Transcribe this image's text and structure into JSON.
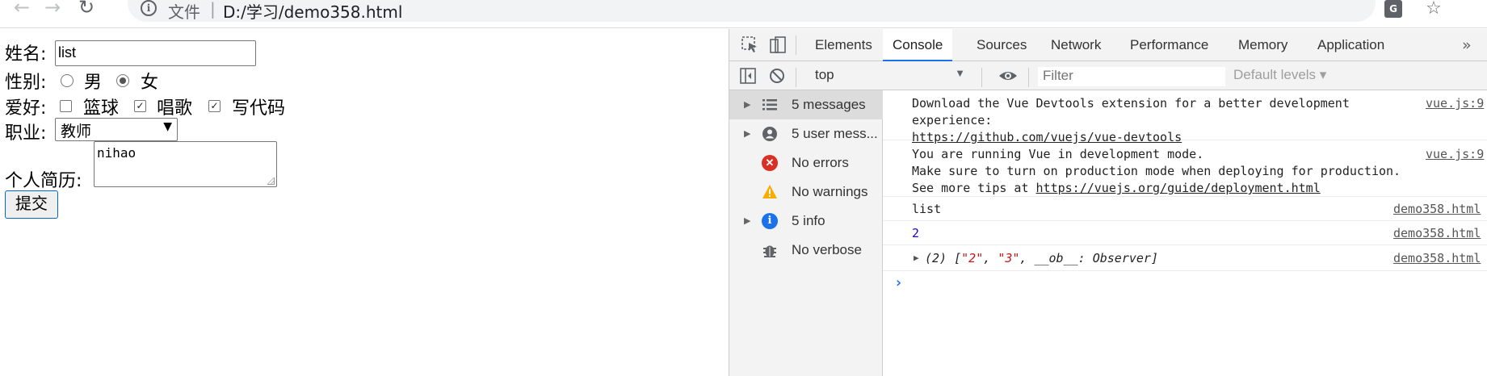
{
  "browser": {
    "back_glyph": "←",
    "forward_glyph": "→",
    "reload_glyph": "↻",
    "info_glyph": "i",
    "file_label": "文件",
    "separator": "|",
    "url": "D:/学习/demo358.html",
    "translate_glyph": "G",
    "star_glyph": "☆"
  },
  "form": {
    "name_label": "姓名:",
    "name_value": "list",
    "gender_label": "性别:",
    "gender_options": [
      "男",
      "女"
    ],
    "gender_selected": "女",
    "hobby_label": "爱好:",
    "hobbies": [
      {
        "label": "篮球",
        "checked": false
      },
      {
        "label": "唱歌",
        "checked": true
      },
      {
        "label": "写代码",
        "checked": true
      }
    ],
    "job_label": "职业:",
    "job_value": "教师",
    "resume_label": "个人简历:",
    "resume_value": "nihao",
    "submit_label": "提交"
  },
  "devtools": {
    "tabs": [
      "Elements",
      "Console",
      "Sources",
      "Network",
      "Performance",
      "Memory",
      "Application"
    ],
    "active_tab": "Console",
    "more_glyph": "»",
    "context": "top",
    "filter_placeholder": "Filter",
    "levels_label": "Default levels ▾",
    "sidebar": [
      {
        "label": "5 messages",
        "icon": "list-icon",
        "expandable": true,
        "selected": true
      },
      {
        "label": "5 user mess...",
        "icon": "user-icon",
        "expandable": true
      },
      {
        "label": "No errors",
        "icon": "error-icon",
        "expandable": false
      },
      {
        "label": "No warnings",
        "icon": "warning-icon",
        "expandable": false
      },
      {
        "label": "5 info",
        "icon": "info-icon",
        "expandable": true
      },
      {
        "label": "No verbose",
        "icon": "bug-icon",
        "expandable": false
      }
    ],
    "messages": [
      {
        "lines": [
          "Download the Vue Devtools extension for a better development",
          "experience:"
        ],
        "link": "https://github.com/vuejs/vue-devtools",
        "source": "vue.js:9"
      },
      {
        "lines": [
          "You are running Vue in development mode.",
          "Make sure to turn on production mode when deploying for production."
        ],
        "prefix": "See more tips at ",
        "link": "https://vuejs.org/guide/deployment.html",
        "source": "vue.js:9"
      },
      {
        "text": "list",
        "source": "demo358.html"
      },
      {
        "text": "2",
        "source": "demo358.html"
      },
      {
        "array_prefix": "(2) [",
        "array_items": [
          "\"2\"",
          "\"3\""
        ],
        "array_rest": "__ob__: Observer]",
        "source": "demo358.html"
      }
    ],
    "prompt_glyph": "›"
  },
  "colors": {
    "accent": "#1a73e8",
    "error": "#d93025",
    "warning": "#f9ab00",
    "info": "#1a73e8"
  }
}
